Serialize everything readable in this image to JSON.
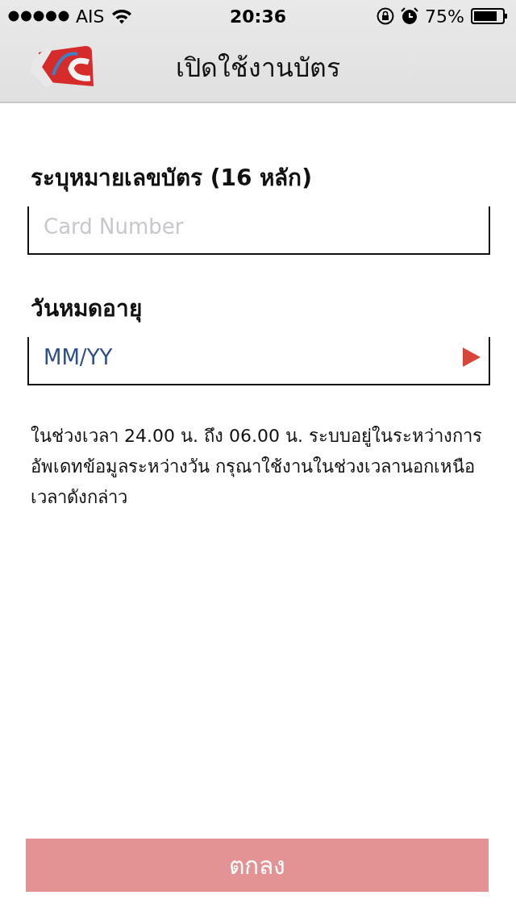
{
  "status_bar": {
    "carrier": "AIS",
    "time": "20:36",
    "battery": "75%"
  },
  "nav_bar": {
    "title": "เปิดใช้งานบัตร"
  },
  "fields": [
    {
      "label": "ระบุหมายเลขบัตร (16 หลัก)",
      "placeholder": "Card Number",
      "kind": "text"
    },
    {
      "label": "วันหมดอายุ",
      "value": "MM/YY",
      "kind": "picker"
    }
  ],
  "note": "ในช่วงเวลา 24.00 น. ถึง 06.00 น. ระบบอยู่ในระหว่างการอัพเดทข้อมูลระหว่างวัน กรุณาใช้งานในช่วงเวลานอกเหนือเวลาดังกล่าว",
  "submit_button": {
    "label": "ตกลง",
    "disabled": true
  }
}
